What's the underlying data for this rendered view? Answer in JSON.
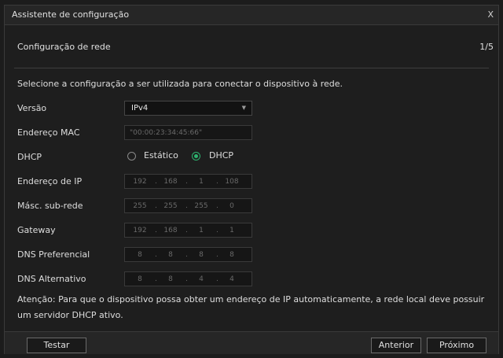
{
  "window": {
    "title": "Assistente de configuração",
    "close_label": "X"
  },
  "step": {
    "title": "Configuração de rede",
    "counter": "1/5"
  },
  "intro": "Selecione a configuração a ser utilizada para conectar o dispositivo à rede.",
  "form": {
    "version": {
      "label": "Versão",
      "value": "IPv4",
      "icon": "chevron-down-icon"
    },
    "mac": {
      "label": "Endereço MAC",
      "value": "\"00:00:23:34:45:66\""
    },
    "dhcp": {
      "label": "DHCP",
      "options": [
        "Estático",
        "DHCP"
      ],
      "selected": "DHCP",
      "accent": "#2db36f"
    },
    "ip": {
      "label": "Endereço de IP",
      "octets": [
        "192",
        "168",
        "1",
        "108"
      ]
    },
    "mask": {
      "label": "Másc. sub-rede",
      "octets": [
        "255",
        "255",
        "255",
        "0"
      ]
    },
    "gateway": {
      "label": "Gateway",
      "octets": [
        "192",
        "168",
        "1",
        "1"
      ]
    },
    "dns1": {
      "label": "DNS Preferencial",
      "octets": [
        "8",
        "8",
        "8",
        "8"
      ]
    },
    "dns2": {
      "label": "DNS Alternativo",
      "octets": [
        "8",
        "8",
        "4",
        "4"
      ]
    }
  },
  "note": "Atenção: Para que o dispositivo possa obter um endereço de IP automaticamente, a rede local deve possuir um servidor DHCP ativo.",
  "footer": {
    "test": "Testar",
    "previous": "Anterior",
    "next": "Próximo"
  }
}
